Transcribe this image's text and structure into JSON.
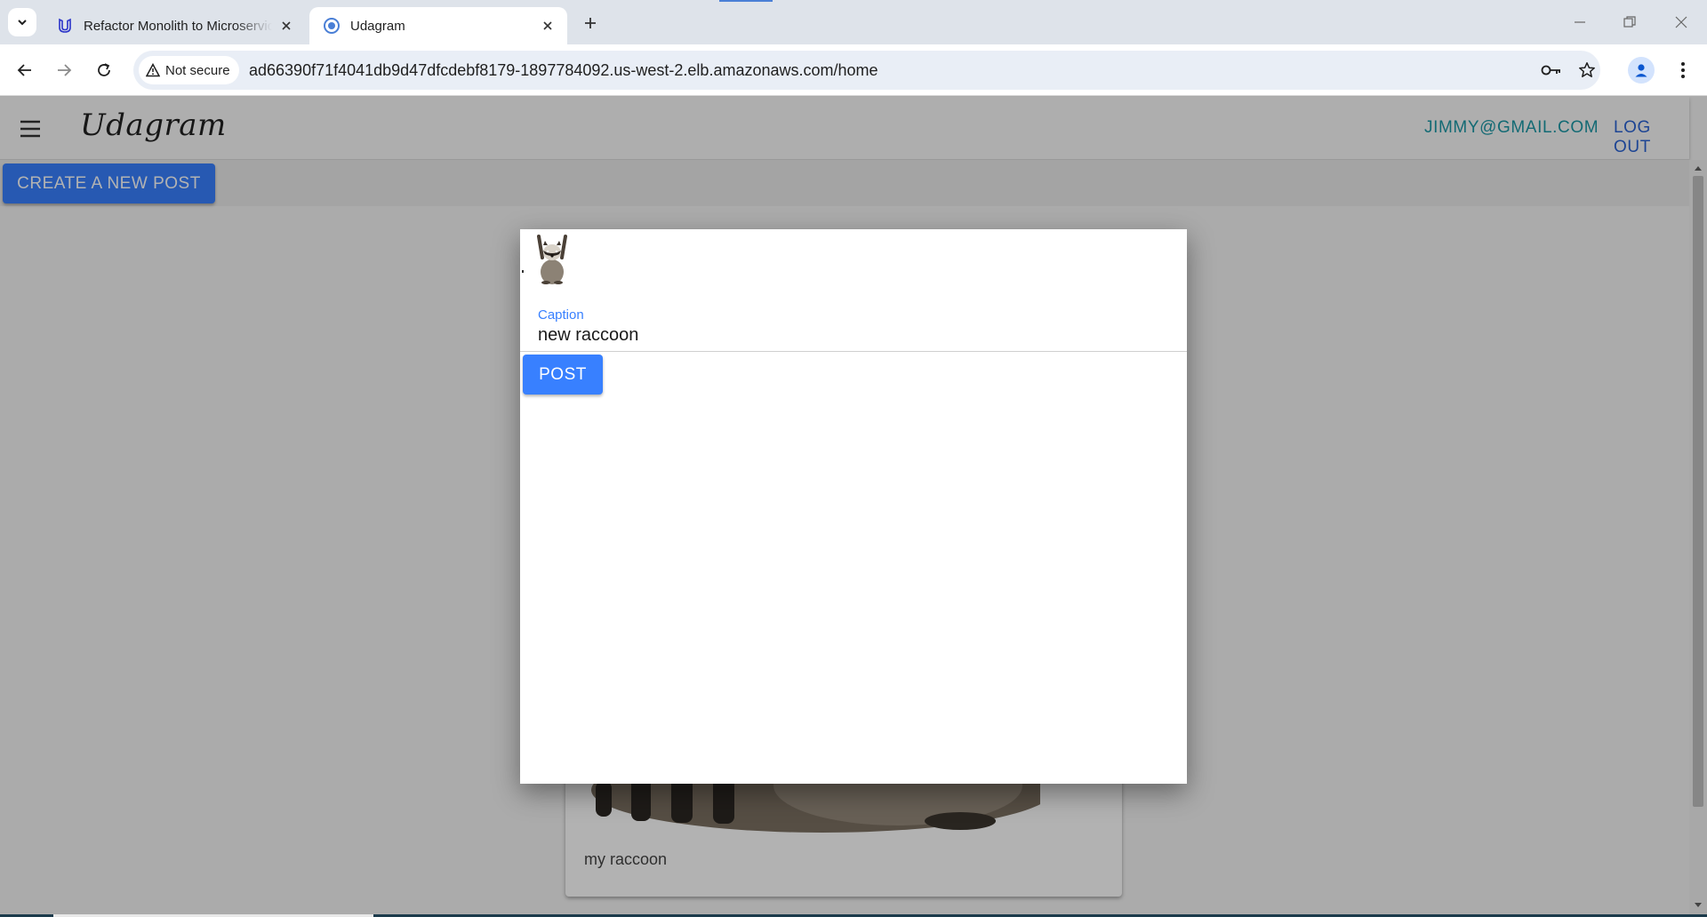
{
  "browser": {
    "tabs": [
      {
        "title": "Refactor Monolith to Microservices",
        "favicon": "udacity-icon"
      },
      {
        "title": "Udagram",
        "favicon": "chrome-loading-icon"
      }
    ],
    "security_label": "Not secure",
    "url": "ad66390f71f4041db9d47dfcdebf8179-1897784092.us-west-2.elb.amazonaws.com/home"
  },
  "app": {
    "brand": "Udagram",
    "user_email": "JIMMY@GMAIL.COM",
    "logout_label": "LOG OUT",
    "create_post_label": "CREATE A NEW POST",
    "accent_color": "#3880ff"
  },
  "feed": [
    {
      "caption": "my raccoon"
    }
  ],
  "modal": {
    "caption_label": "Caption",
    "caption_value": "new raccoon",
    "post_label": "POST"
  }
}
